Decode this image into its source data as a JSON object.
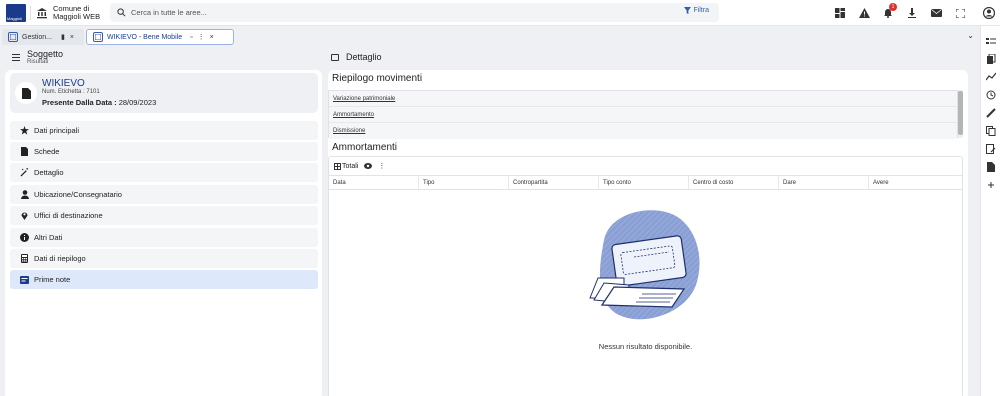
{
  "colors": {
    "brand": "#1b3a8c",
    "accent": "#2e5fb8",
    "active_bg": "#dde8fb",
    "badge": "#e03131"
  },
  "topbar": {
    "logo_text": "Maggioli",
    "app_name_line1": "Comune di",
    "app_name_line2": "Maggioli WEB",
    "search_placeholder": "Cerca in tutte le aree...",
    "filter_label": "Filtra",
    "notification_count": "1",
    "icons": [
      "dashboard-icon",
      "warning-icon",
      "bell-icon",
      "download-icon",
      "mail-icon",
      "fullscreen-icon",
      "user-avatar-icon"
    ]
  },
  "tabs": [
    {
      "label": "Gestion...",
      "pinned": true
    },
    {
      "label": "WIKIEVO - Bene Mobile",
      "active": true
    }
  ],
  "left": {
    "header_title": "Soggetto",
    "header_subtitle": "Risultati",
    "card": {
      "title": "WIKIEVO",
      "label_num": "Num. Etichetta : ",
      "num_value": "7101",
      "label_date": "Presente Dalla Data : ",
      "date_value": "28/09/2023"
    },
    "menu": [
      {
        "label": "Dati principali",
        "icon": "star-icon"
      },
      {
        "label": "Schede",
        "icon": "document-icon"
      },
      {
        "label": "Dettaglio",
        "icon": "magic-wand-icon"
      },
      {
        "label": "Ubicazione/Consegnatario",
        "icon": "person-icon"
      },
      {
        "label": "Uffici di destinazione",
        "icon": "map-pin-icon"
      },
      {
        "label": "Altri Dati",
        "icon": "info-icon"
      },
      {
        "label": "Dati di riepilogo",
        "icon": "calculator-icon"
      },
      {
        "label": "Prime note",
        "icon": "note-icon",
        "active": true
      }
    ]
  },
  "right": {
    "header_title": "Dettaglio",
    "riepilogo_title": "Riepilogo movimenti",
    "movimenti": [
      "Variazione patrimoniale",
      "Ammortamento",
      "Dismissione"
    ],
    "ammortamenti_title": "Ammortamenti",
    "toolbar_totali": "Totali",
    "columns": [
      "Data",
      "Tipo",
      "Contropartita",
      "Tipo conto",
      "Centro di costo",
      "Dare",
      "Avere"
    ],
    "empty_message": "Nessun risultato disponibile."
  }
}
